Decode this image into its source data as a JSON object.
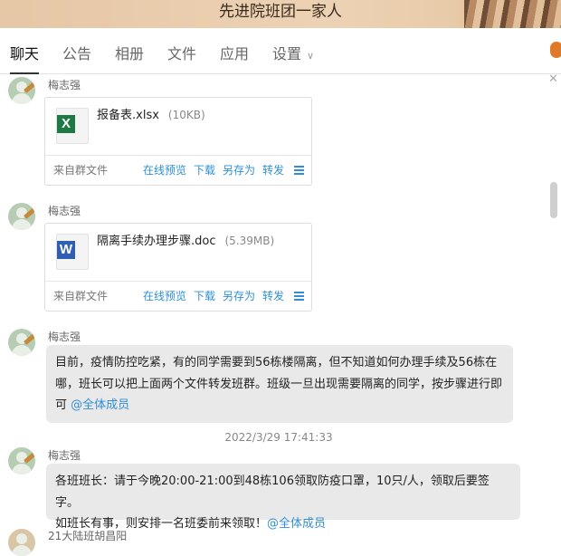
{
  "window": {
    "title": "先进院班团一家人"
  },
  "tabs": {
    "chat": "聊天",
    "notice": "公告",
    "album": "相册",
    "files": "文件",
    "apps": "应用",
    "settings": "设置"
  },
  "messages": [
    {
      "sender": "梅志强",
      "file": {
        "name": "报备表.xlsx",
        "size": "(10KB)",
        "type": "xlsx",
        "icon": "excel-icon"
      },
      "source": "来自群文件",
      "actions": [
        "在线预览",
        "下载",
        "另存为",
        "转发"
      ]
    },
    {
      "sender": "梅志强",
      "file": {
        "name": "隔离手续办理步骤.doc",
        "size": "(5.39MB)",
        "type": "doc",
        "icon": "word-icon"
      },
      "source": "来自群文件",
      "actions": [
        "在线预览",
        "下载",
        "另存为",
        "转发"
      ]
    },
    {
      "sender": "梅志强",
      "text": {
        "line1": "目前，疫情防控吃紧，有的同学需要到56栋楼隔离，但不知道如何办理手续及56栋在",
        "line2": "哪，班长可以把上面两个文件转发班群。班级一旦出现需要隔离的同学，按步骤进行即",
        "line3": "可 ",
        "mention": "@全体成员"
      }
    },
    {
      "timestamp": "2022/3/29 17:41:33"
    },
    {
      "sender": "梅志强",
      "text": {
        "line1": "各班班长：请于今晚20:00-21:00到48栋106领取防疫口罩，10只/人，领取后要签字。",
        "line2": "如班长有事，则安排一名班委前来领取！",
        "mention": "@全体成员"
      }
    },
    {
      "sender": "21大陆班胡昌阳"
    }
  ],
  "colors": {
    "link": "#2f8fd6",
    "bubble": "#e9e9e9",
    "excel": "#1e7a45",
    "word": "#2f5fb3"
  }
}
